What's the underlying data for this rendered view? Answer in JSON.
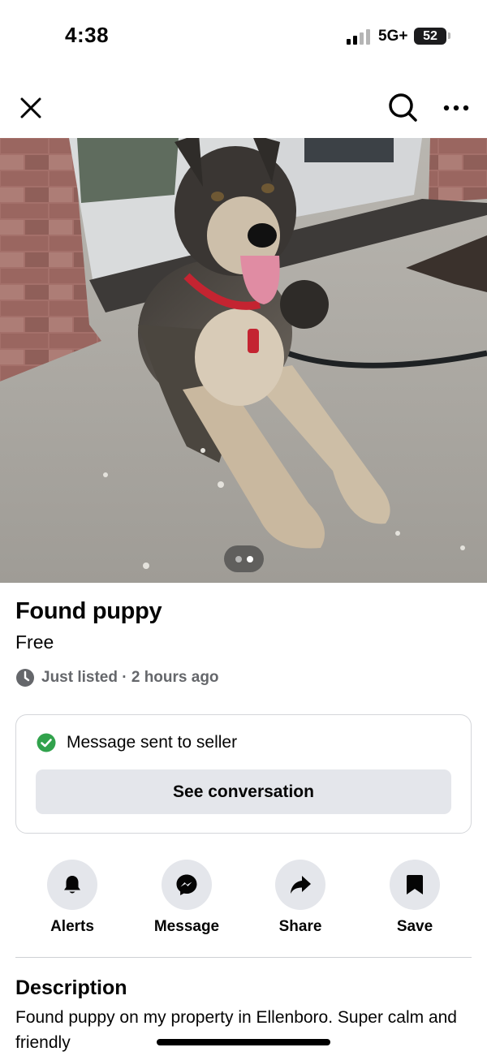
{
  "status_bar": {
    "time": "4:38",
    "network": "5G+",
    "battery": "52"
  },
  "nav": {
    "close_icon": "close-icon",
    "search_icon": "search-icon",
    "more_icon": "more-horizontal-icon"
  },
  "photo": {
    "page_count": 2,
    "current_page": 2
  },
  "listing": {
    "title": "Found puppy",
    "price": "Free",
    "listed_text": "Just listed · 2 hours ago"
  },
  "message_card": {
    "status_text": "Message sent to seller",
    "button_label": "See conversation",
    "status_color": "#31a24c"
  },
  "actions": [
    {
      "label": "Alerts",
      "icon": "bell-icon"
    },
    {
      "label": "Message",
      "icon": "messenger-icon"
    },
    {
      "label": "Share",
      "icon": "share-arrow-icon"
    },
    {
      "label": "Save",
      "icon": "bookmark-icon"
    }
  ],
  "description": {
    "heading": "Description",
    "body": "Found puppy on my property in Ellenboro. Super calm and friendly"
  }
}
